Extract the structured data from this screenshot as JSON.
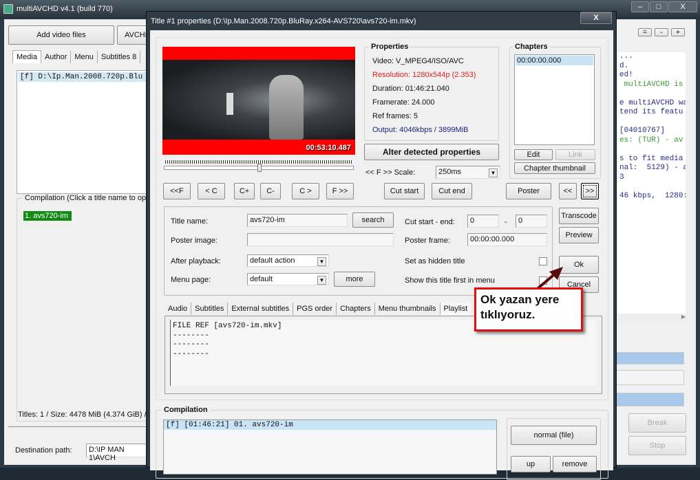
{
  "main": {
    "title": "multiAVCHD v4.1 (build 770)",
    "add_video": "Add video files",
    "avchd": "AVCHD",
    "tabs": [
      "Media",
      "Author",
      "Menu",
      "Subtitles 8"
    ],
    "media_item": "[f] D:\\Ip.Man.2008.720p.Blu",
    "compilation_label": "Compilation (Click a title name to ope",
    "compilation_item": "1. avs720-im",
    "status": "Titles: 1 / Size: 4478 MiB (4.374 GiB) / E",
    "dest_label": "Destination path:",
    "dest_value": "D:\\IP MAN 1\\AVCH",
    "zoom_buttons": [
      "=",
      "-",
      "+"
    ],
    "log_lines": [
      {
        "t": "...",
        "c": "#2a2a8a"
      },
      {
        "t": "d.",
        "c": "#2a2a8a"
      },
      {
        "t": "ed!",
        "c": "#2a2a8a"
      },
      {
        "t": " multiAVCHD is",
        "c": "#3a9a3a"
      },
      {
        "t": "",
        "c": "#000"
      },
      {
        "t": "e multiAVCHD wa",
        "c": "#2a2a8a"
      },
      {
        "t": "tend its featu",
        "c": "#2a2a8a"
      },
      {
        "t": "",
        "c": "#000"
      },
      {
        "t": "[04010767]",
        "c": "#2a2a8a"
      },
      {
        "t": "es: (TUR) - av",
        "c": "#3a9a3a"
      },
      {
        "t": "",
        "c": "#000"
      },
      {
        "t": "s to fit media",
        "c": "#2a2a8a"
      },
      {
        "t": "nal:  5129) - a",
        "c": "#2a2a8a"
      },
      {
        "t": "3",
        "c": "#2a2a8a"
      },
      {
        "t": "",
        "c": "#000"
      },
      {
        "t": "46 kbps,  1280:",
        "c": "#2a2a8a"
      }
    ],
    "break": "Break",
    "stop": "Stop"
  },
  "dialog": {
    "title": "Title #1 properties (D:\\Ip.Man.2008.720p.BluRay.x264-AVS720\\avs720-im.mkv)",
    "close": "X",
    "timecode": "00:53:10.487",
    "seek_position": 0.5,
    "nav_buttons": [
      "<<F",
      "< C",
      "C+",
      "C-",
      "C >",
      "F >>"
    ],
    "properties": {
      "heading": "Properties",
      "video": "Video: V_MPEG4/ISO/AVC",
      "resolution": "Resolution: 1280x544p (2.353)",
      "duration": "Duration: 01:46:21.040",
      "framerate": "Framerate: 24.000",
      "ref_frames": "Ref frames: 5",
      "output": "Output: 4046kbps / 3899MiB"
    },
    "alter": "Alter detected properties",
    "scale_label": "<< F >> Scale:",
    "scale_value": "250ms",
    "cut_start": "Cut start",
    "cut_end": "Cut end",
    "chapters": {
      "heading": "Chapters",
      "items": [
        "00:00:00.000"
      ],
      "edit": "Edit",
      "link": "Link",
      "thumbnail": "Chapter thumbnail"
    },
    "poster": "Poster",
    "prev": "<<",
    "next": ">>",
    "form": {
      "title_name_label": "Title name:",
      "title_name": "avs720-im",
      "search": "search",
      "poster_image_label": "Poster image:",
      "poster_image": "",
      "after_playback_label": "After playback:",
      "after_playback": "default action",
      "menu_page_label": "Menu page:",
      "menu_page": "default",
      "more": "more",
      "cut_label": "Cut start - end:",
      "cut_start_val": "0",
      "cut_dash": "-",
      "cut_end_val": "0",
      "poster_frame_label": "Poster frame:",
      "poster_frame": "00:00:00.000",
      "hidden_label": "Set as hidden title",
      "first_label": "Show this title first in menu"
    },
    "side_buttons": {
      "transcode": "Transcode",
      "preview": "Preview",
      "ok": "Ok",
      "cancel": "Cancel"
    },
    "tabs": [
      "Audio",
      "Subtitles",
      "External subtitles",
      "PGS order",
      "Chapters",
      "Menu thumbnails",
      "Playlist"
    ],
    "playlist_lines": [
      "FILE REF [avs720-im.mkv]",
      "--------",
      "--------",
      "--------"
    ],
    "compilation": {
      "heading": "Compilation",
      "items": [
        "[f] [01:46:21] 01. avs720-im"
      ],
      "normal": "normal (file)",
      "up": "up",
      "remove": "remove"
    }
  },
  "annotation": {
    "text_line1": "Ok yazan yere",
    "text_line2": "tıklıyoruz.",
    "color": "#e01010"
  }
}
